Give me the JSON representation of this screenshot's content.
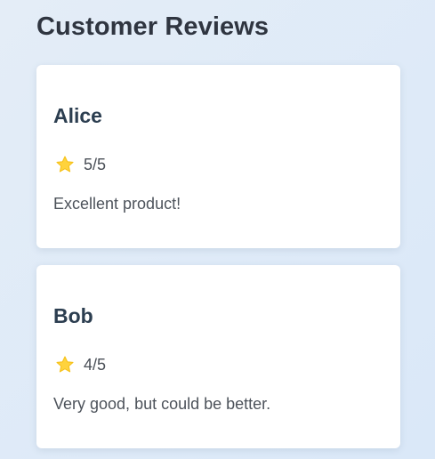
{
  "header": {
    "title": "Customer Reviews"
  },
  "reviews": [
    {
      "name": "Alice",
      "rating": "5/5",
      "text": "Excellent product!"
    },
    {
      "name": "Bob",
      "rating": "4/5",
      "text": "Very good, but could be better."
    }
  ],
  "icons": {
    "rating": "star-icon"
  },
  "colors": {
    "star": "#ffd33d",
    "card": "#ffffff",
    "name": "#2c3e50"
  }
}
